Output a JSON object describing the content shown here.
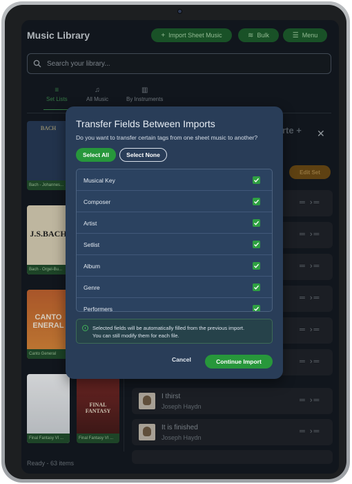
{
  "app": {
    "title": "Music Library",
    "import_button": "Import Sheet Music",
    "bulk_button": "Bulk",
    "menu_button": "Menu",
    "search_placeholder": "Search your library...",
    "tabs": [
      {
        "label": "Set Lists",
        "active": true
      },
      {
        "label": "All Music",
        "active": false
      },
      {
        "label": "By Instruments",
        "active": false
      }
    ],
    "status": "Ready - 63 items"
  },
  "library_cards": [
    {
      "caption": "Bach - Johannes...",
      "cover_text": "BACH"
    },
    {
      "caption": "Bach - Orgel-Bu...",
      "cover_text": "J.S.BACH"
    },
    {
      "caption": "Canto General",
      "cover_text": "CANTO ENERAL"
    },
    {
      "caption": "Final Fantasy VI ...",
      "cover_text": ""
    },
    {
      "caption": "Final Fantasy VI ...",
      "cover_text": "FINAL FANTASY"
    }
  ],
  "right_panel": {
    "title_fragment": "rte +",
    "edit_set_button": "Edit Set",
    "rows": [
      {
        "title": "",
        "subtitle": ""
      },
      {
        "title": "",
        "subtitle": ""
      },
      {
        "title": "",
        "subtitle": ""
      },
      {
        "title": "",
        "subtitle": ""
      },
      {
        "title": "",
        "subtitle": ""
      },
      {
        "title": "",
        "subtitle": ""
      },
      {
        "title": "I thirst",
        "subtitle": "Joseph Haydn"
      },
      {
        "title": "It is finished",
        "subtitle": "Joseph Haydn"
      }
    ]
  },
  "modal": {
    "title": "Transfer Fields Between Imports",
    "subtitle": "Do you want to transfer certain tags from one sheet music to another?",
    "select_all": "Select All",
    "select_none": "Select None",
    "fields": [
      {
        "label": "Musical Key",
        "checked": true
      },
      {
        "label": "Composer",
        "checked": true
      },
      {
        "label": "Artist",
        "checked": true
      },
      {
        "label": "Setlist",
        "checked": true
      },
      {
        "label": "Album",
        "checked": true
      },
      {
        "label": "Genre",
        "checked": true
      },
      {
        "label": "Performers",
        "checked": true
      }
    ],
    "info_line1": "Selected fields will be automatically filled from the previous import.",
    "info_line2": "You can still modify them for each file.",
    "cancel": "Cancel",
    "continue": "Continue Import"
  },
  "colors": {
    "accent_green": "#27973b",
    "modal_bg": "#293d58",
    "edit_orange": "#6b4a15"
  }
}
